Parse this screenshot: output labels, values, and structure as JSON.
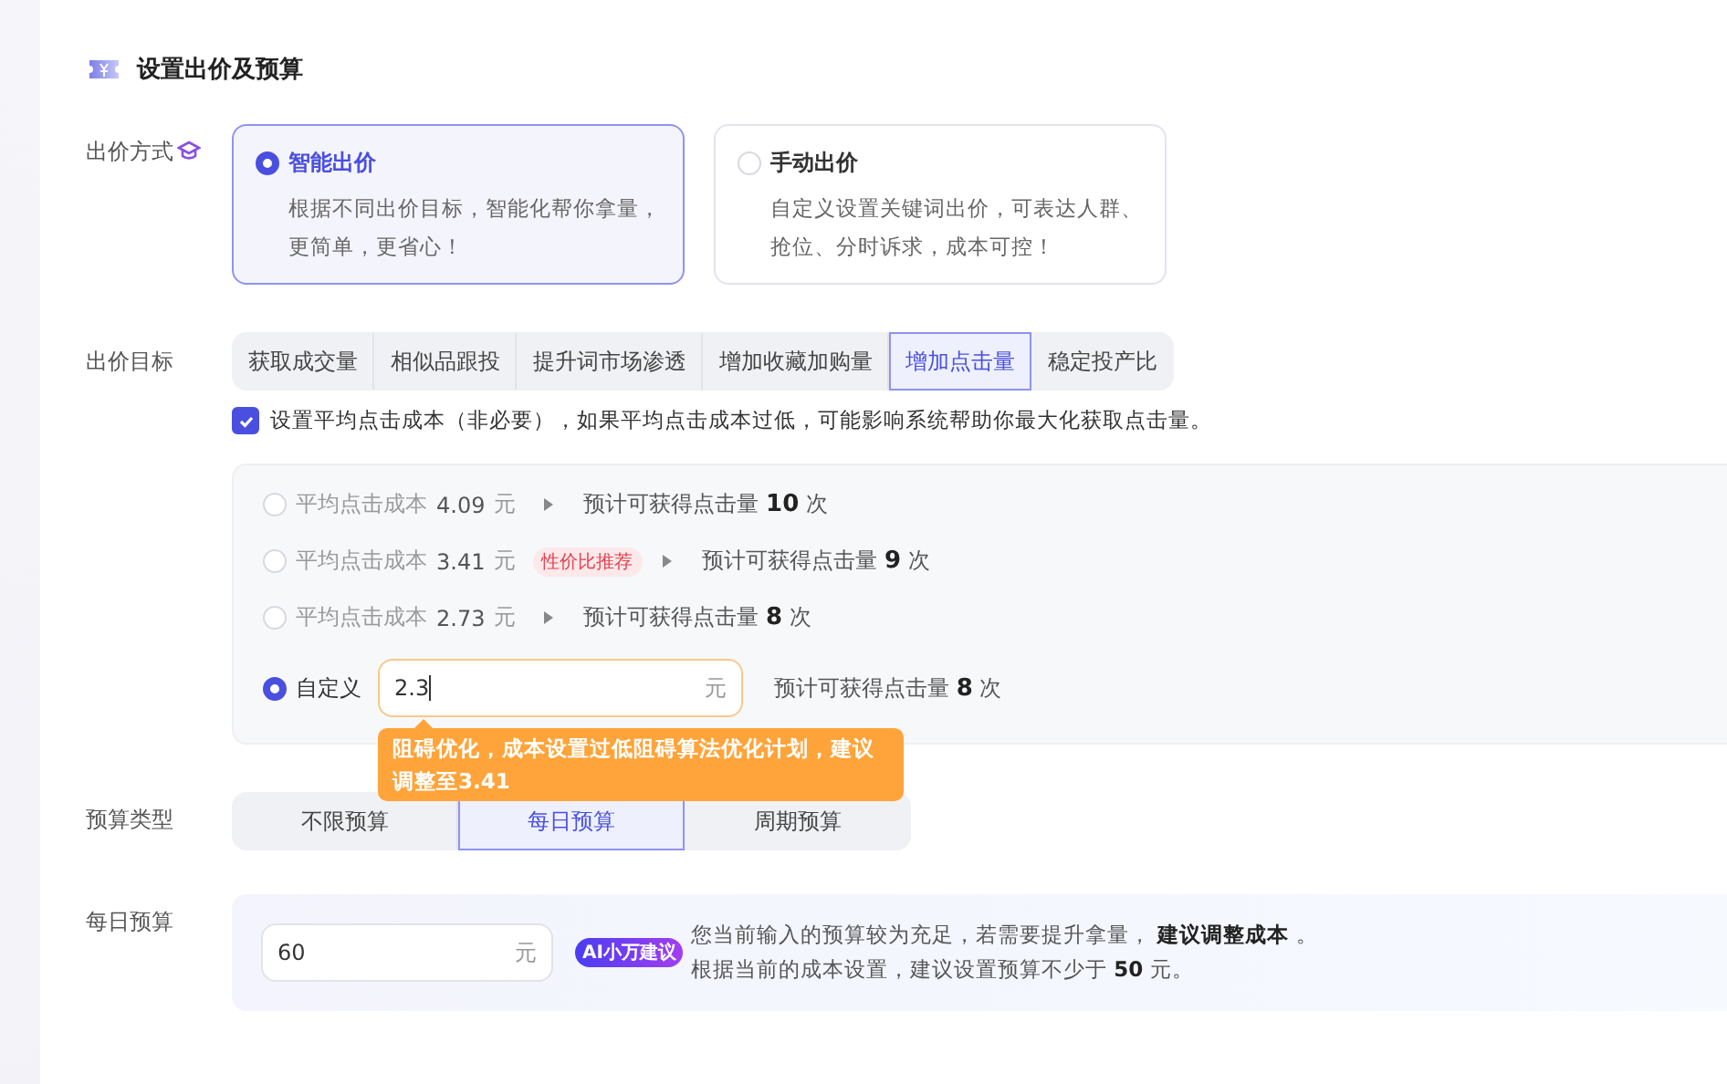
{
  "section": {
    "title": "设置出价及预算"
  },
  "bid_method": {
    "label": "出价方式",
    "options": [
      {
        "title": "智能出价",
        "desc": "根据不同出价目标，智能化帮你拿量，更简单，更省心！",
        "selected": true
      },
      {
        "title": "手动出价",
        "desc": "自定义设置关键词出价，可表达人群、抢位、分时诉求，成本可控！",
        "selected": false
      }
    ]
  },
  "bid_goal": {
    "label": "出价目标",
    "tabs": [
      {
        "label": "获取成交量",
        "selected": false
      },
      {
        "label": "相似品跟投",
        "selected": false
      },
      {
        "label": "提升词市场渗透",
        "selected": false
      },
      {
        "label": "增加收藏加购量",
        "selected": false
      },
      {
        "label": "增加点击量",
        "selected": true
      },
      {
        "label": "稳定投产比",
        "selected": false
      }
    ],
    "checkbox": {
      "label": "设置平均点击成本（非必要），如果平均点击成本过低，可能影响系统帮助你最大化获取点击量。",
      "checked": true
    }
  },
  "cost_options": [
    {
      "kind": "preset",
      "label": "平均点击成本",
      "value": "4.09",
      "unit": "元",
      "estimate": "预计可获得点击量 **10** 次",
      "selected": false
    },
    {
      "kind": "preset",
      "label": "平均点击成本",
      "value": "3.41",
      "unit": "元",
      "badge": "性价比推荐",
      "estimate": "预计可获得点击量 **9** 次",
      "selected": false
    },
    {
      "kind": "preset",
      "label": "平均点击成本",
      "value": "2.73",
      "unit": "元",
      "estimate": "预计可获得点击量 **8** 次",
      "selected": false
    },
    {
      "kind": "custom",
      "label": "自定义",
      "value": "2.3",
      "unit": "元",
      "estimate": "预计可获得点击量 **8** 次",
      "selected": true,
      "warning": "阻碍优化，成本设置过低阻碍算法优化计划，建议调整至3.41"
    }
  ],
  "budget_type": {
    "label": "预算类型",
    "tabs": [
      {
        "label": "不限预算",
        "selected": false
      },
      {
        "label": "每日预算",
        "selected": true
      },
      {
        "label": "周期预算",
        "selected": false
      }
    ]
  },
  "daily_budget": {
    "label": "每日预算",
    "value": "60",
    "unit": "元",
    "ai_badge": "AI小万建议",
    "lines": [
      "您当前输入的预算较为充足，若需要提升拿量， **建议调整成本** 。",
      "根据当前的成本设置，建议设置预算不少于 **50** 元。"
    ]
  }
}
